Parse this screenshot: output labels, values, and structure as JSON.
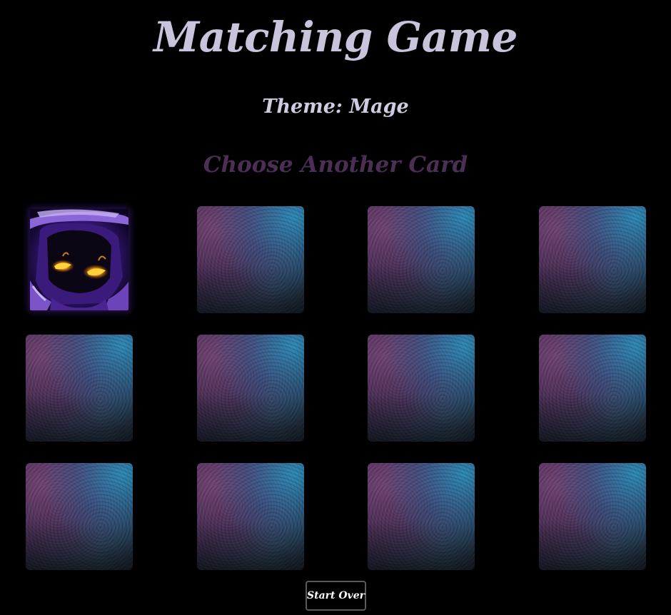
{
  "header": {
    "title": "Matching Game",
    "theme_label": "Theme: Mage",
    "status_prompt": "Choose Another Card"
  },
  "board": {
    "rows": 3,
    "columns": 4,
    "cards": [
      {
        "state": "revealed",
        "face_icon": "mage-hooded-icon"
      },
      {
        "state": "face-down"
      },
      {
        "state": "face-down"
      },
      {
        "state": "face-down"
      },
      {
        "state": "face-down"
      },
      {
        "state": "face-down"
      },
      {
        "state": "face-down"
      },
      {
        "state": "face-down"
      },
      {
        "state": "face-down"
      },
      {
        "state": "face-down"
      },
      {
        "state": "face-down"
      },
      {
        "state": "face-down"
      }
    ]
  },
  "controls": {
    "start_over_label": "Start Over"
  },
  "colors": {
    "title": "#c9c4dc",
    "theme": "#d0cce0",
    "prompt": "#4b2f54",
    "button_text": "#ffffff",
    "background": "#000000"
  }
}
